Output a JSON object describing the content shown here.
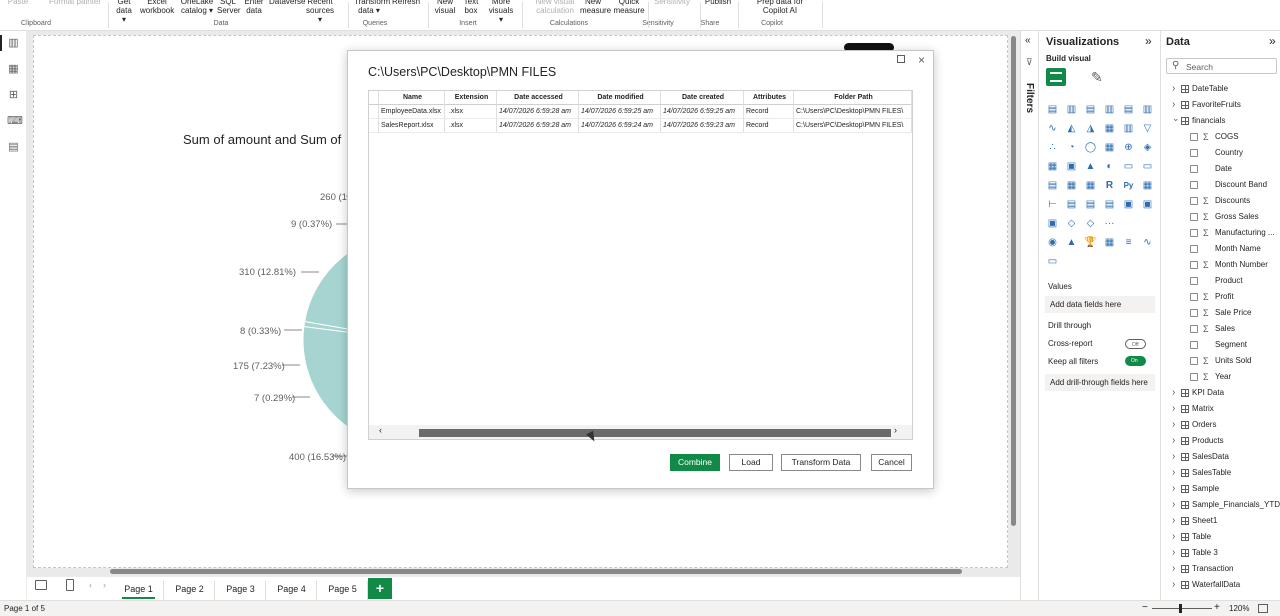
{
  "ribbon": {
    "items": [
      {
        "label": "Paste",
        "dim": true
      },
      {
        "label": "Format painter",
        "dim": true
      },
      {
        "label": "Get data ▾"
      },
      {
        "label": "Excel workbook"
      },
      {
        "label": "OneLake catalog ▾"
      },
      {
        "label": "SQL Server"
      },
      {
        "label": "Enter data"
      },
      {
        "label": "Dataverse"
      },
      {
        "label": "Recent sources ▾"
      },
      {
        "label": "Transform data ▾"
      },
      {
        "label": "Refresh"
      },
      {
        "label": "New visual"
      },
      {
        "label": "Text box"
      },
      {
        "label": "More visuals ▾"
      },
      {
        "label": "New visual calculation",
        "dim": true
      },
      {
        "label": "New measure"
      },
      {
        "label": "Quick measure"
      },
      {
        "label": "Sensitivity",
        "dim": true
      },
      {
        "label": "Publish"
      },
      {
        "label": "Prep data for Copilot AI"
      }
    ],
    "groups": [
      "Clipboard",
      "Data",
      "Queries",
      "Insert",
      "Calculations",
      "Sensitivity",
      "Share",
      "Copilot"
    ]
  },
  "chart": {
    "title": "Sum of amount and Sum of",
    "labels": [
      "260 (10.",
      "9 (0.37%)",
      "310 (12.81%)",
      "8 (0.33%)",
      "175 (7.23%)",
      "7 (0.29%)",
      "400 (16.53%)"
    ]
  },
  "chart_data": {
    "type": "pie",
    "title": "Sum of amount and Sum of",
    "values": [
      260,
      9,
      310,
      8,
      175,
      7,
      400
    ],
    "labels": [
      "260 (10.",
      "9 (0.37%)",
      "310 (12.81%)",
      "8 (0.33%)",
      "175 (7.23%)",
      "7 (0.29%)",
      "400 (16.53%)"
    ],
    "colors": [
      "#a6d5d1",
      "#f0a3b0",
      "#f2e68c"
    ]
  },
  "tabs": [
    "Page 1",
    "Page 2",
    "Page 3",
    "Page 4",
    "Page 5"
  ],
  "add_page": "+",
  "status": {
    "page": "Page 1 of 5",
    "zoom": "120%",
    "zoom_minus": "−",
    "zoom_plus": "+"
  },
  "filters": {
    "label": "Filters"
  },
  "viz": {
    "title": "Visualizations",
    "build": "Build visual",
    "values": "Values",
    "add_data": "Add data fields here",
    "drill": "Drill through",
    "cross_report": "Cross-report",
    "cross_state": "Off",
    "keep_filters": "Keep all filters",
    "keep_state": "On",
    "add_drill": "Add drill-through fields here",
    "more": "···"
  },
  "data_pane": {
    "title": "Data",
    "search_placeholder": "Search",
    "tables_before": [
      "DateTable",
      "FavoriteFruits"
    ],
    "expanded_table": "financials",
    "fields": [
      {
        "name": "COGS",
        "sigma": true
      },
      {
        "name": "Country",
        "sigma": false
      },
      {
        "name": "Date",
        "sigma": false
      },
      {
        "name": "Discount Band",
        "sigma": false
      },
      {
        "name": "Discounts",
        "sigma": true
      },
      {
        "name": "Gross Sales",
        "sigma": true
      },
      {
        "name": "Manufacturing ...",
        "sigma": true
      },
      {
        "name": "Month Name",
        "sigma": false
      },
      {
        "name": "Month Number",
        "sigma": true
      },
      {
        "name": "Product",
        "sigma": false
      },
      {
        "name": "Profit",
        "sigma": true
      },
      {
        "name": "Sale Price",
        "sigma": true
      },
      {
        "name": "Sales",
        "sigma": true
      },
      {
        "name": "Segment",
        "sigma": false
      },
      {
        "name": "Units Sold",
        "sigma": true
      },
      {
        "name": "Year",
        "sigma": true
      }
    ],
    "tables_after": [
      "KPI Data",
      "Matrix",
      "Orders",
      "Products",
      "SalesData",
      "SalesTable",
      "Sample",
      "Sample_Financials_YTD",
      "Sheet1",
      "Table",
      "Table 3",
      "Transaction",
      "WaterfallData"
    ]
  },
  "modal": {
    "title": "C:\\Users\\PC\\Desktop\\PMN FILES",
    "columns": [
      "Name",
      "Extension",
      "Date accessed",
      "Date modified",
      "Date created",
      "Attributes",
      "Folder Path"
    ],
    "rows": [
      [
        "EmployeeData.xlsx",
        ".xlsx",
        "14/07/2026 6:59:28 am",
        "14/07/2026 6:59:25 am",
        "14/07/2026 6:59:25 am",
        "Record",
        "C:\\Users\\PC\\Desktop\\PMN FILES\\"
      ],
      [
        "SalesReport.xlsx",
        ".xlsx",
        "14/07/2026 6:59:28 am",
        "14/07/2026 6:59:24 am",
        "14/07/2026 6:59:23 am",
        "Record",
        "C:\\Users\\PC\\Desktop\\PMN FILES\\"
      ]
    ],
    "buttons": {
      "combine": "Combine",
      "load": "Load",
      "transform": "Transform Data",
      "cancel": "Cancel"
    },
    "close": "×"
  }
}
